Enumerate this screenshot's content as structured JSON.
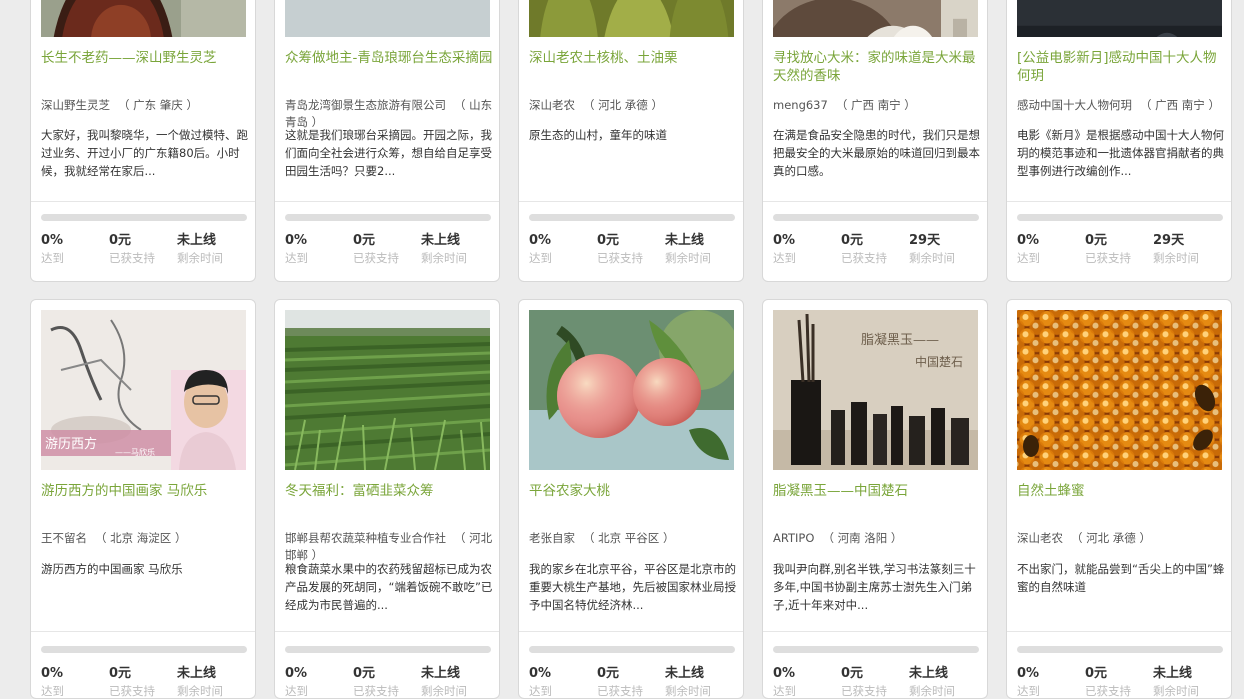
{
  "colors": {
    "accent": "#7aa53a",
    "background": "#ececec",
    "card": "#ffffff",
    "progress_track": "#dedede",
    "muted": "#bbbbbb"
  },
  "stat_labels": {
    "reached": "达到",
    "support": "已获支持",
    "remaining": "剩余时间"
  },
  "projects": [
    {
      "title": "长生不老药——深山野生灵芝",
      "owner": "深山野生灵芝",
      "location": "（ 广东 肇庆 ）",
      "description": "大家好，我叫黎晓华，一个做过模特、跑过业务、开过小厂的广东籍80后。小时候，我就经常在家后...",
      "progress": 0,
      "reached": "0%",
      "support": "0元",
      "remaining": "未上线"
    },
    {
      "title": "众筹做地主-青岛琅琊台生态采摘园",
      "owner": "青岛龙湾御景生态旅游有限公司",
      "location": "（ 山东 青岛 ）",
      "description": "这就是我们琅琊台采摘园。开园之际，我们面向全社会进行众筹，想自给自足享受田园生活吗？只要2...",
      "progress": 0,
      "reached": "0%",
      "support": "0元",
      "remaining": "未上线"
    },
    {
      "title": "深山老农土核桃、土油栗",
      "owner": "深山老农",
      "location": "（ 河北 承德 ）",
      "description": "原生态的山村，童年的味道",
      "progress": 0,
      "reached": "0%",
      "support": "0元",
      "remaining": "未上线"
    },
    {
      "title": "寻找放心大米：家的味道是大米最天然的香味",
      "owner": "meng637",
      "location": "（ 广西 南宁 ）",
      "description": "在满是食品安全隐患的时代，我们只是想把最安全的大米最原始的味道回归到最本真的口感。",
      "progress": 0,
      "reached": "0%",
      "support": "0元",
      "remaining": "29天"
    },
    {
      "title": "[公益电影新月]感动中国十大人物何玥",
      "owner": "感动中国十大人物何玥",
      "location": "（ 广西 南宁 ）",
      "description": "电影《新月》是根据感动中国十大人物何玥的模范事迹和一批遗体器官捐献者的典型事例进行改编创作...",
      "progress": 0,
      "reached": "0%",
      "support": "0元",
      "remaining": "29天"
    },
    {
      "title": "游历西方的中国画家 马欣乐",
      "owner": "王不留名",
      "location": "（ 北京 海淀区 ）",
      "description": "游历西方的中国画家 马欣乐",
      "image_text": "游历西方",
      "image_subtext": "——马欣乐",
      "progress": 0,
      "reached": "0%",
      "support": "0元",
      "remaining": "未上线"
    },
    {
      "title": "冬天福利：富硒韭菜众筹",
      "owner": "邯郸县帮农蔬菜种植专业合作社",
      "location": "（ 河北 邯郸 ）",
      "description": "粮食蔬菜水果中的农药残留超标已成为农产品发展的死胡同，“端着饭碗不敢吃”已经成为市民普遍的...",
      "progress": 0,
      "reached": "0%",
      "support": "0元",
      "remaining": "未上线"
    },
    {
      "title": "平谷农家大桃",
      "owner": "老张自家",
      "location": "（ 北京 平谷区 ）",
      "description": "我的家乡在北京平谷，平谷区是北京市的重要大桃生产基地，先后被国家林业局授予中国名特优经济林...",
      "progress": 0,
      "reached": "0%",
      "support": "0元",
      "remaining": "未上线"
    },
    {
      "title": "脂凝黑玉——中国楚石",
      "owner": "ARTIPO",
      "location": "（ 河南 洛阳 ）",
      "description": "我叫尹向群,别名半铁,学习书法篆刻三十多年,中国书协副主席苏士澍先生入门弟子,近十年来对中...",
      "image_text": "脂凝黑玉——",
      "image_subtext": "中国楚石",
      "progress": 0,
      "reached": "0%",
      "support": "0元",
      "remaining": "未上线"
    },
    {
      "title": "自然土蜂蜜",
      "owner": "深山老农",
      "location": "（ 河北 承德 ）",
      "description": "不出家门，就能品尝到“舌尖上的中国”蜂蜜的自然味道",
      "progress": 0,
      "reached": "0%",
      "support": "0元",
      "remaining": "未上线"
    }
  ]
}
